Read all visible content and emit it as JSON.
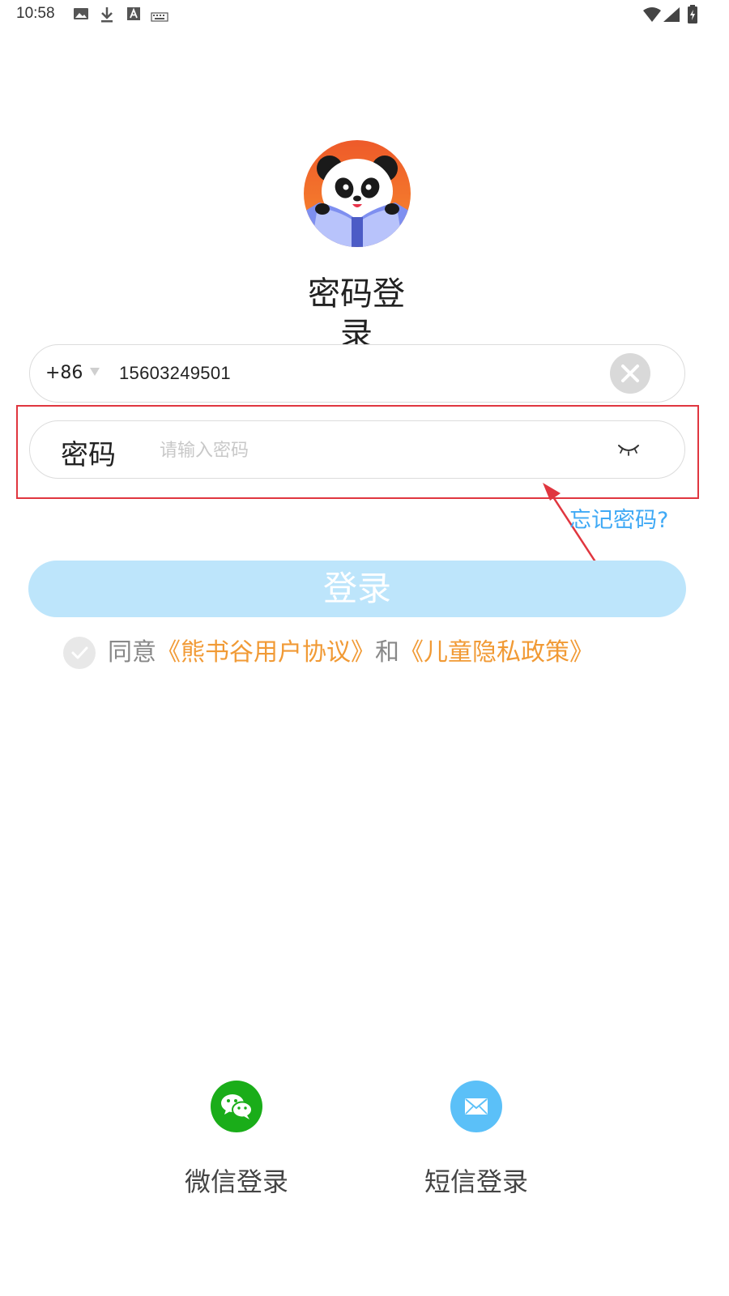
{
  "status_bar": {
    "time": "10:58",
    "icons": [
      "image-icon",
      "download-icon",
      "a-icon",
      "keyboard-icon",
      "wifi-icon",
      "signal-icon",
      "battery-icon"
    ]
  },
  "header": {
    "logo_icon": "panda-reading-book-logo",
    "title": "密码登录"
  },
  "phone": {
    "country_code": "+86",
    "number": "15603249501"
  },
  "password": {
    "label": "密码",
    "placeholder": "请输入密码"
  },
  "forgot_password": "忘记密码?",
  "login_button": "登录",
  "agreement": {
    "prefix": "同意",
    "user_agreement": "《熊书谷用户协议》",
    "and": "和",
    "privacy_policy": "《儿童隐私政策》"
  },
  "alt_logins": {
    "wechat": {
      "label": "微信登录",
      "icon": "wechat-icon",
      "color": "#1aad19"
    },
    "sms": {
      "label": "短信登录",
      "icon": "mail-icon",
      "color": "#5bc0f8"
    }
  },
  "colors": {
    "accent_blue": "#3fa9f5",
    "login_button_bg": "#bde5fb",
    "link_orange": "#f19a35",
    "annotation_red": "#e0363f"
  }
}
